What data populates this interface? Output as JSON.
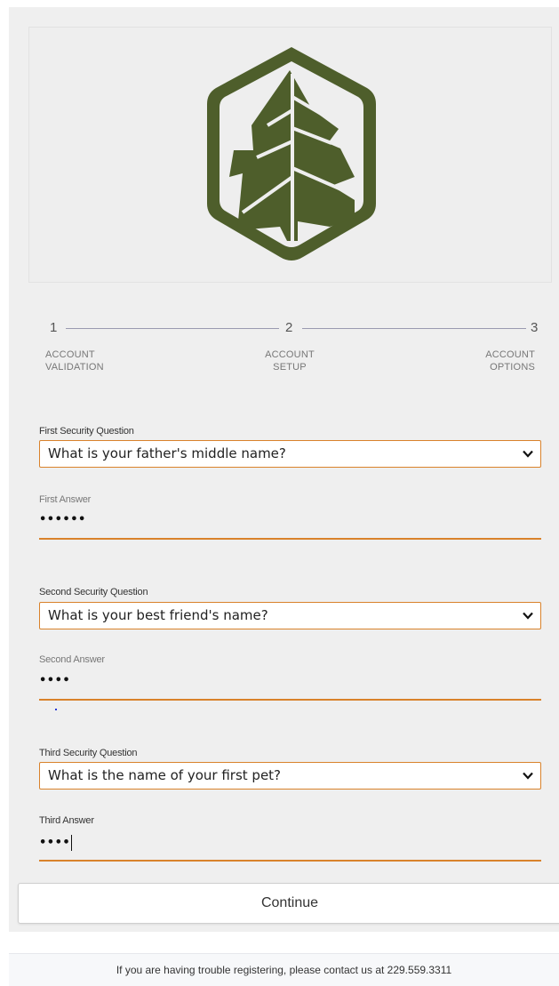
{
  "logo": {
    "icon": "tree-hexagon-logo",
    "color": "#4e5e2b"
  },
  "stepper": {
    "steps": [
      {
        "number": "1",
        "label_line1": "ACCOUNT",
        "label_line2": "VALIDATION"
      },
      {
        "number": "2",
        "label_line1": "ACCOUNT",
        "label_line2": "SETUP"
      },
      {
        "number": "3",
        "label_line1": "ACCOUNT",
        "label_line2": "OPTIONS"
      }
    ]
  },
  "form": {
    "q1": {
      "label": "First Security Question",
      "value": "What is your father's middle name?"
    },
    "a1": {
      "label": "First Answer",
      "value": "••••••"
    },
    "q2": {
      "label": "Second Security Question",
      "value": "What is your best friend's name?"
    },
    "a2": {
      "label": "Second Answer",
      "value": "••••"
    },
    "q3": {
      "label": "Third Security Question",
      "value": "What is the name of your first pet?"
    },
    "a3": {
      "label": "Third Answer",
      "value": "••••"
    },
    "accent_color": "#d9822b"
  },
  "continue_label": "Continue",
  "footer_text": "If you are having trouble registering, please contact us at 229.559.3311"
}
